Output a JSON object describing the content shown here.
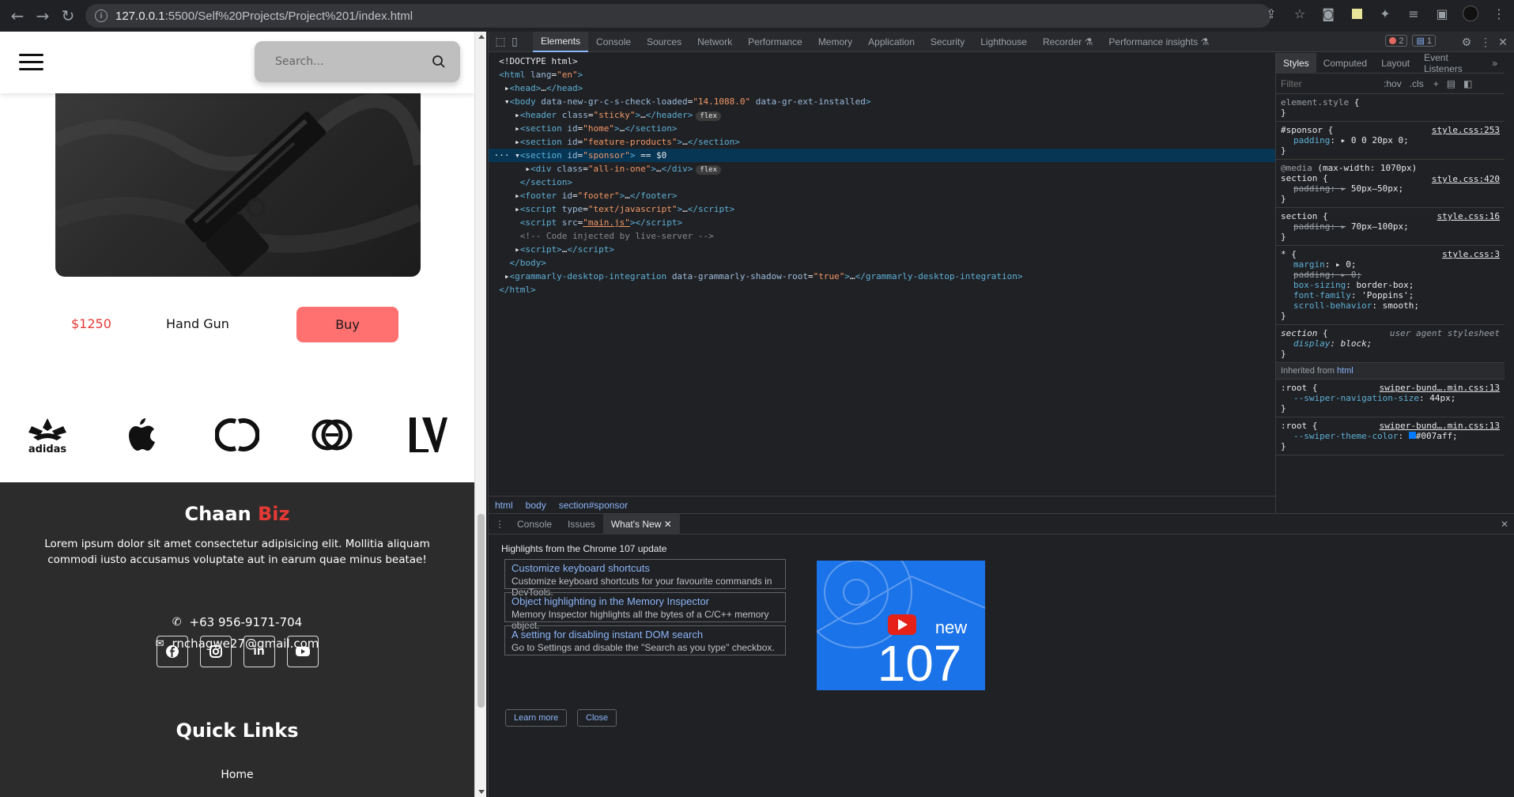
{
  "browser": {
    "url_host": "127.0.0.1",
    "url_path": ":5500/Self%20Projects/Project%201/index.html"
  },
  "site": {
    "search_placeholder": "Search...",
    "product": {
      "price": "$1250",
      "name": "Hand Gun",
      "buy_label": "Buy"
    },
    "brands": [
      "adidas",
      "apple",
      "chanel",
      "gucci",
      "louis-vuitton"
    ],
    "brand_adidas_text": "adidas",
    "footer": {
      "brand_main": "Chaan ",
      "brand_accent": "Biz",
      "description": "Lorem ipsum dolor sit amet consectetur adipisicing elit. Mollitia aliquam commodi iusto accusamus voluptate aut in earum quae minus beatae!",
      "phone": "+63 956-9171-704",
      "email": "rnchagwe27@gmail.com",
      "quick_links_title": "Quick Links",
      "home_link": "Home"
    }
  },
  "devtools": {
    "tabs": [
      "Elements",
      "Console",
      "Sources",
      "Network",
      "Performance",
      "Memory",
      "Application",
      "Security",
      "Lighthouse",
      "Recorder",
      "Performance insights"
    ],
    "error_count": "2",
    "message_count": "1",
    "breadcrumbs": [
      "html",
      "body",
      "section#sponsor"
    ],
    "styles_tabs": [
      "Styles",
      "Computed",
      "Layout",
      "Event Listeners"
    ],
    "filter_placeholder": "Filter",
    "filter_hov": ":hov",
    "filter_cls": ".cls",
    "inherited_from": "Inherited from",
    "inherited_tag": "html",
    "drawer_tabs": [
      "Console",
      "Issues",
      "What's New"
    ],
    "whats_new_title": "Highlights from the Chrome 107 update",
    "cards": [
      {
        "title": "Customize keyboard shortcuts",
        "desc": "Customize keyboard shortcuts for your favourite commands in DevTools."
      },
      {
        "title": "Object highlighting in the Memory Inspector",
        "desc": "Memory Inspector highlights all the bytes of a C/C++ memory object."
      },
      {
        "title": "A setting for disabling instant DOM search",
        "desc": "Go to Settings and disable the \"Search as you type\" checkbox."
      }
    ],
    "learn_more": "Learn more",
    "close": "Close",
    "promo_new": "new",
    "promo_version": "107"
  },
  "colors": {
    "accent_red": "#e53935",
    "buy_button": "#ff7070",
    "footer_bg": "#2c2c2c",
    "devtools_bg": "#202124",
    "link_blue": "#8ab4f8",
    "promo_blue": "#1a73e8"
  }
}
